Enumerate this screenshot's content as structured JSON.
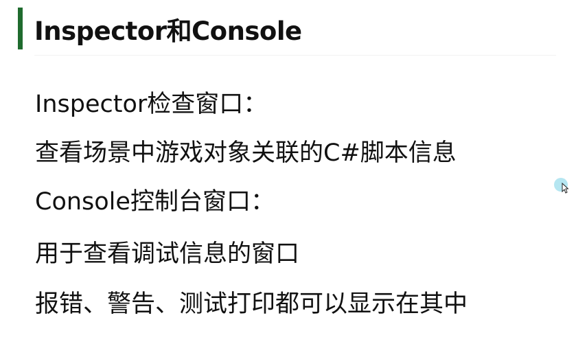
{
  "slide": {
    "title": "Inspector和Console",
    "lines": [
      "Inspector检查窗口：",
      "查看场景中游戏对象关联的C#脚本信息",
      "Console控制台窗口：",
      "用于查看调试信息的窗口",
      "报错、警告、测试打印都可以显示在其中"
    ]
  },
  "colors": {
    "accent_bar": "#1f6b2e",
    "text": "#111111",
    "background": "#ffffff",
    "cursor_highlight": "#78d2e6"
  },
  "icons": {
    "cursor": "mouse-pointer-icon"
  }
}
